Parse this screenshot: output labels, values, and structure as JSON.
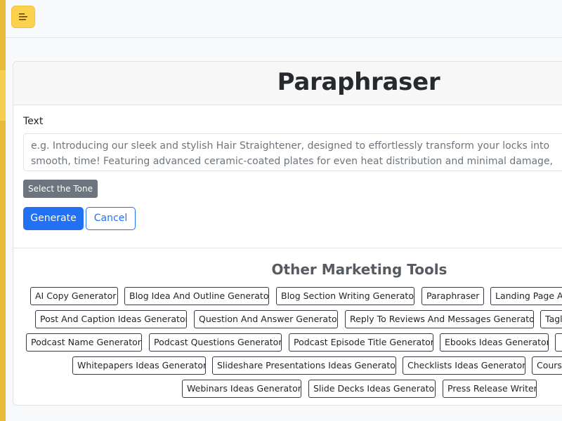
{
  "colors": {
    "accent": "#2371f3",
    "menu_button": "#fcd14d",
    "tone_button": "#6c757d",
    "sidebar_stripe": "#e9b93a"
  },
  "topbar": {
    "menu_icon": "hamburger-menu-icon"
  },
  "page": {
    "title": "Paraphraser"
  },
  "form": {
    "text_label": "Text",
    "text_placeholder": "e.g. Introducing our sleek and stylish Hair Straightener, designed to effortlessly transform your locks into smooth, time! Featuring advanced ceramic-coated plates for even heat distribution and minimal damage, this lightweig",
    "tone_button": "Select the Tone",
    "generate_button": "Generate",
    "cancel_button": "Cancel"
  },
  "other_tools": {
    "title": "Other Marketing Tools",
    "rows": [
      [
        "AI Copy Generator",
        "Blog Idea And Outline Generator",
        "Blog Section Writing Generator",
        "Paraphraser",
        "Landing Page An"
      ],
      [
        "Post And Caption Ideas Generator",
        "Question And Answer Generator",
        "Reply To Reviews And Messages Generator",
        "Tagl"
      ],
      [
        "Podcast Name Generator",
        "Podcast Questions Generator",
        "Podcast Episode Title Generator",
        "Ebooks Ideas Generator",
        ""
      ],
      [
        "Whitepapers Ideas Generator",
        "Slideshare Presentations Ideas Generator",
        "Checklists Ideas Generator",
        "Cours"
      ],
      [
        "Webinars Ideas Generator",
        "Slide Decks Ideas Generator",
        "Press Release Writer"
      ]
    ]
  }
}
